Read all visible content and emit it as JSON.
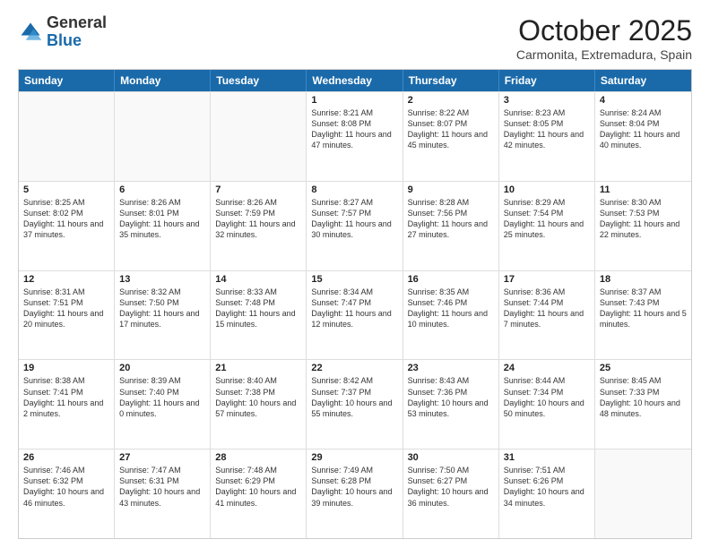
{
  "logo": {
    "general": "General",
    "blue": "Blue"
  },
  "header": {
    "month": "October 2025",
    "location": "Carmonita, Extremadura, Spain"
  },
  "weekdays": [
    "Sunday",
    "Monday",
    "Tuesday",
    "Wednesday",
    "Thursday",
    "Friday",
    "Saturday"
  ],
  "rows": [
    [
      {
        "day": "",
        "empty": true
      },
      {
        "day": "",
        "empty": true
      },
      {
        "day": "",
        "empty": true
      },
      {
        "day": "1",
        "sunrise": "8:21 AM",
        "sunset": "8:08 PM",
        "daylight": "11 hours and 47 minutes."
      },
      {
        "day": "2",
        "sunrise": "8:22 AM",
        "sunset": "8:07 PM",
        "daylight": "11 hours and 45 minutes."
      },
      {
        "day": "3",
        "sunrise": "8:23 AM",
        "sunset": "8:05 PM",
        "daylight": "11 hours and 42 minutes."
      },
      {
        "day": "4",
        "sunrise": "8:24 AM",
        "sunset": "8:04 PM",
        "daylight": "11 hours and 40 minutes."
      }
    ],
    [
      {
        "day": "5",
        "sunrise": "8:25 AM",
        "sunset": "8:02 PM",
        "daylight": "11 hours and 37 minutes."
      },
      {
        "day": "6",
        "sunrise": "8:26 AM",
        "sunset": "8:01 PM",
        "daylight": "11 hours and 35 minutes."
      },
      {
        "day": "7",
        "sunrise": "8:26 AM",
        "sunset": "7:59 PM",
        "daylight": "11 hours and 32 minutes."
      },
      {
        "day": "8",
        "sunrise": "8:27 AM",
        "sunset": "7:57 PM",
        "daylight": "11 hours and 30 minutes."
      },
      {
        "day": "9",
        "sunrise": "8:28 AM",
        "sunset": "7:56 PM",
        "daylight": "11 hours and 27 minutes."
      },
      {
        "day": "10",
        "sunrise": "8:29 AM",
        "sunset": "7:54 PM",
        "daylight": "11 hours and 25 minutes."
      },
      {
        "day": "11",
        "sunrise": "8:30 AM",
        "sunset": "7:53 PM",
        "daylight": "11 hours and 22 minutes."
      }
    ],
    [
      {
        "day": "12",
        "sunrise": "8:31 AM",
        "sunset": "7:51 PM",
        "daylight": "11 hours and 20 minutes."
      },
      {
        "day": "13",
        "sunrise": "8:32 AM",
        "sunset": "7:50 PM",
        "daylight": "11 hours and 17 minutes."
      },
      {
        "day": "14",
        "sunrise": "8:33 AM",
        "sunset": "7:48 PM",
        "daylight": "11 hours and 15 minutes."
      },
      {
        "day": "15",
        "sunrise": "8:34 AM",
        "sunset": "7:47 PM",
        "daylight": "11 hours and 12 minutes."
      },
      {
        "day": "16",
        "sunrise": "8:35 AM",
        "sunset": "7:46 PM",
        "daylight": "11 hours and 10 minutes."
      },
      {
        "day": "17",
        "sunrise": "8:36 AM",
        "sunset": "7:44 PM",
        "daylight": "11 hours and 7 minutes."
      },
      {
        "day": "18",
        "sunrise": "8:37 AM",
        "sunset": "7:43 PM",
        "daylight": "11 hours and 5 minutes."
      }
    ],
    [
      {
        "day": "19",
        "sunrise": "8:38 AM",
        "sunset": "7:41 PM",
        "daylight": "11 hours and 2 minutes."
      },
      {
        "day": "20",
        "sunrise": "8:39 AM",
        "sunset": "7:40 PM",
        "daylight": "11 hours and 0 minutes."
      },
      {
        "day": "21",
        "sunrise": "8:40 AM",
        "sunset": "7:38 PM",
        "daylight": "10 hours and 57 minutes."
      },
      {
        "day": "22",
        "sunrise": "8:42 AM",
        "sunset": "7:37 PM",
        "daylight": "10 hours and 55 minutes."
      },
      {
        "day": "23",
        "sunrise": "8:43 AM",
        "sunset": "7:36 PM",
        "daylight": "10 hours and 53 minutes."
      },
      {
        "day": "24",
        "sunrise": "8:44 AM",
        "sunset": "7:34 PM",
        "daylight": "10 hours and 50 minutes."
      },
      {
        "day": "25",
        "sunrise": "8:45 AM",
        "sunset": "7:33 PM",
        "daylight": "10 hours and 48 minutes."
      }
    ],
    [
      {
        "day": "26",
        "sunrise": "7:46 AM",
        "sunset": "6:32 PM",
        "daylight": "10 hours and 46 minutes."
      },
      {
        "day": "27",
        "sunrise": "7:47 AM",
        "sunset": "6:31 PM",
        "daylight": "10 hours and 43 minutes."
      },
      {
        "day": "28",
        "sunrise": "7:48 AM",
        "sunset": "6:29 PM",
        "daylight": "10 hours and 41 minutes."
      },
      {
        "day": "29",
        "sunrise": "7:49 AM",
        "sunset": "6:28 PM",
        "daylight": "10 hours and 39 minutes."
      },
      {
        "day": "30",
        "sunrise": "7:50 AM",
        "sunset": "6:27 PM",
        "daylight": "10 hours and 36 minutes."
      },
      {
        "day": "31",
        "sunrise": "7:51 AM",
        "sunset": "6:26 PM",
        "daylight": "10 hours and 34 minutes."
      },
      {
        "day": "",
        "empty": true
      }
    ]
  ]
}
